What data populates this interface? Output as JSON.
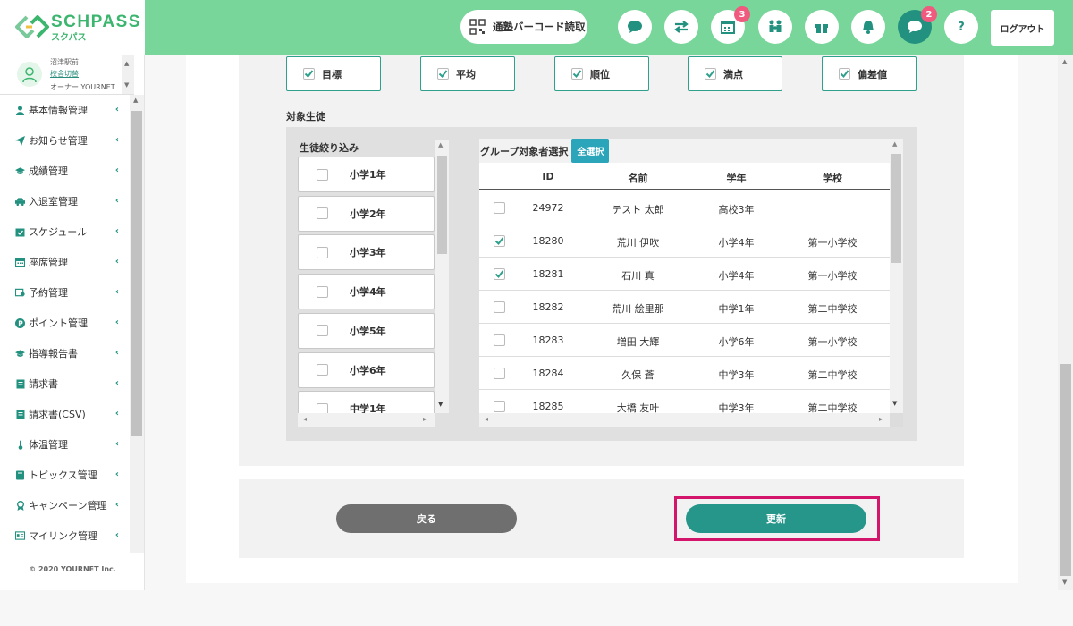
{
  "brand": {
    "name": "SCHPASS",
    "sub": "スクパス",
    "color": "#3cb66e"
  },
  "header": {
    "barcode_label": "通塾バーコード読取",
    "logout_label": "ログアウト",
    "badges": {
      "calendar": "3",
      "messages": "2"
    },
    "help_label": "?"
  },
  "user": {
    "school": "沼津駅前",
    "switch_label": "校舎切替",
    "role": "オーナー YOURNET"
  },
  "sidebar": {
    "items": [
      {
        "label": "基本情報管理",
        "icon": "person-icon"
      },
      {
        "label": "お知らせ管理",
        "icon": "send-icon"
      },
      {
        "label": "成績管理",
        "icon": "graduation-cap-icon"
      },
      {
        "label": "入退室管理",
        "icon": "car-icon"
      },
      {
        "label": "スケジュール",
        "icon": "calendar-check-icon"
      },
      {
        "label": "座席管理",
        "icon": "calendar-grid-icon"
      },
      {
        "label": "予約管理",
        "icon": "reservation-icon"
      },
      {
        "label": "ポイント管理",
        "icon": "point-icon"
      },
      {
        "label": "指導報告書",
        "icon": "graduation-cap-icon"
      },
      {
        "label": "請求書",
        "icon": "invoice-icon"
      },
      {
        "label": "請求書(CSV)",
        "icon": "invoice-icon"
      },
      {
        "label": "体温管理",
        "icon": "thermometer-icon"
      },
      {
        "label": "トピックス管理",
        "icon": "book-icon"
      },
      {
        "label": "キャンペーン管理",
        "icon": "award-icon"
      },
      {
        "label": "マイリンク管理",
        "icon": "id-card-icon"
      }
    ],
    "copyright": "© 2020 YOURNET Inc."
  },
  "score_options": [
    {
      "label": "目標",
      "checked": true
    },
    {
      "label": "平均",
      "checked": true
    },
    {
      "label": "順位",
      "checked": true
    },
    {
      "label": "満点",
      "checked": true
    },
    {
      "label": "偏差値",
      "checked": true
    }
  ],
  "target_students_label": "対象生徒",
  "filter": {
    "title": "生徒絞り込み",
    "items": [
      "小学1年",
      "小学2年",
      "小学3年",
      "小学4年",
      "小学5年",
      "小学6年",
      "中学1年"
    ]
  },
  "group": {
    "title": "グループ対象者選択",
    "select_all": "全選択",
    "columns": {
      "id": "ID",
      "name": "名前",
      "grade": "学年",
      "school": "学校"
    },
    "rows": [
      {
        "id": "24972",
        "name": "テスト 太郎",
        "grade": "高校3年",
        "school": "",
        "checked": false
      },
      {
        "id": "18280",
        "name": "荒川 伊吹",
        "grade": "小学4年",
        "school": "第一小学校",
        "checked": true
      },
      {
        "id": "18281",
        "name": "石川 真",
        "grade": "小学4年",
        "school": "第一小学校",
        "checked": true
      },
      {
        "id": "18282",
        "name": "荒川 絵里那",
        "grade": "中学1年",
        "school": "第二中学校",
        "checked": false
      },
      {
        "id": "18283",
        "name": "増田 大輝",
        "grade": "小学6年",
        "school": "第一小学校",
        "checked": false
      },
      {
        "id": "18284",
        "name": "久保 蒼",
        "grade": "中学3年",
        "school": "第二中学校",
        "checked": false
      },
      {
        "id": "18285",
        "name": "大橋 友叶",
        "grade": "中学3年",
        "school": "第二中学校",
        "checked": false
      }
    ]
  },
  "actions": {
    "back": "戻る",
    "update": "更新"
  },
  "colors": {
    "header_bg": "#79d69a",
    "accent": "#26968a",
    "highlight": "#d4156c",
    "select_all_bg": "#2aa5b9"
  }
}
